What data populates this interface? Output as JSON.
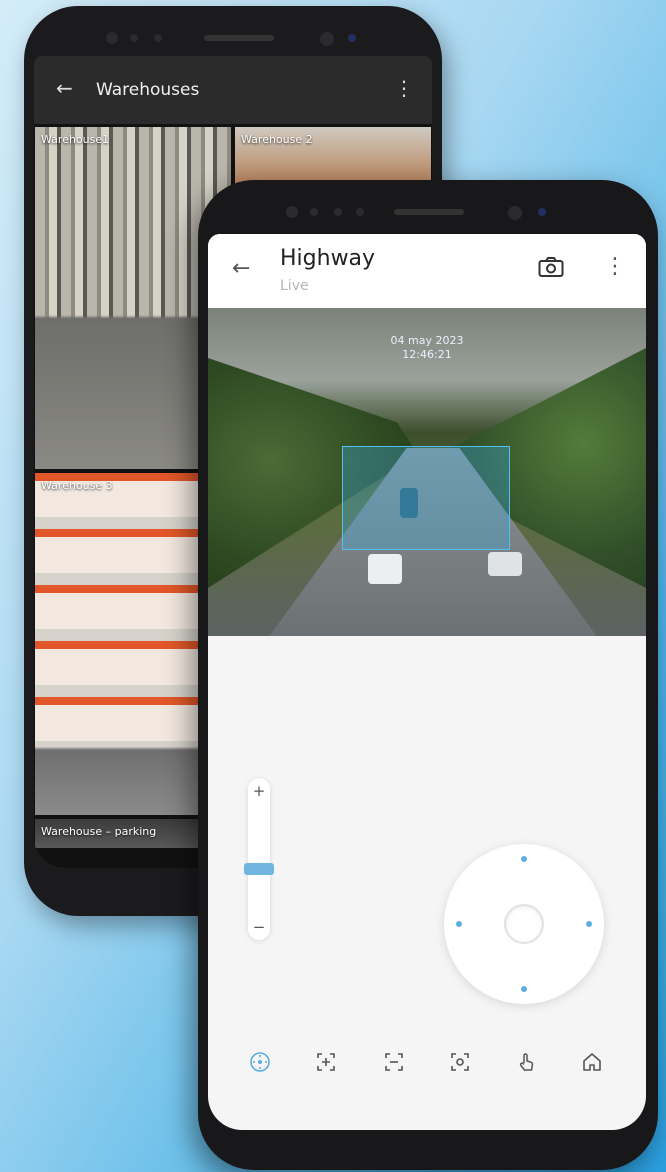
{
  "back_screen": {
    "title": "Warehouses",
    "back_glyph": "←",
    "more_glyph": "⋮",
    "tiles": [
      {
        "label": "Warehouse1"
      },
      {
        "label": "Warehouse 2"
      },
      {
        "label": "Warehouse 3"
      },
      {
        "label": "Warehouse – parking"
      }
    ]
  },
  "front_screen": {
    "title": "Highway",
    "subtitle": "Live",
    "back_glyph": "←",
    "more_glyph": "⋮",
    "date": "04 may 2023",
    "time": "12:46:21",
    "zoom": {
      "plus": "+",
      "minus": "−",
      "level": 0.4
    },
    "toolbar": [
      "ptz-icon",
      "zoom-in-icon",
      "zoom-out-icon",
      "focus-icon",
      "touch-icon",
      "home-icon"
    ]
  },
  "colors": {
    "accent": "#5aaee2",
    "detection_box": "#4fc0f0",
    "background_gradient_end": "#2a9fe0"
  }
}
